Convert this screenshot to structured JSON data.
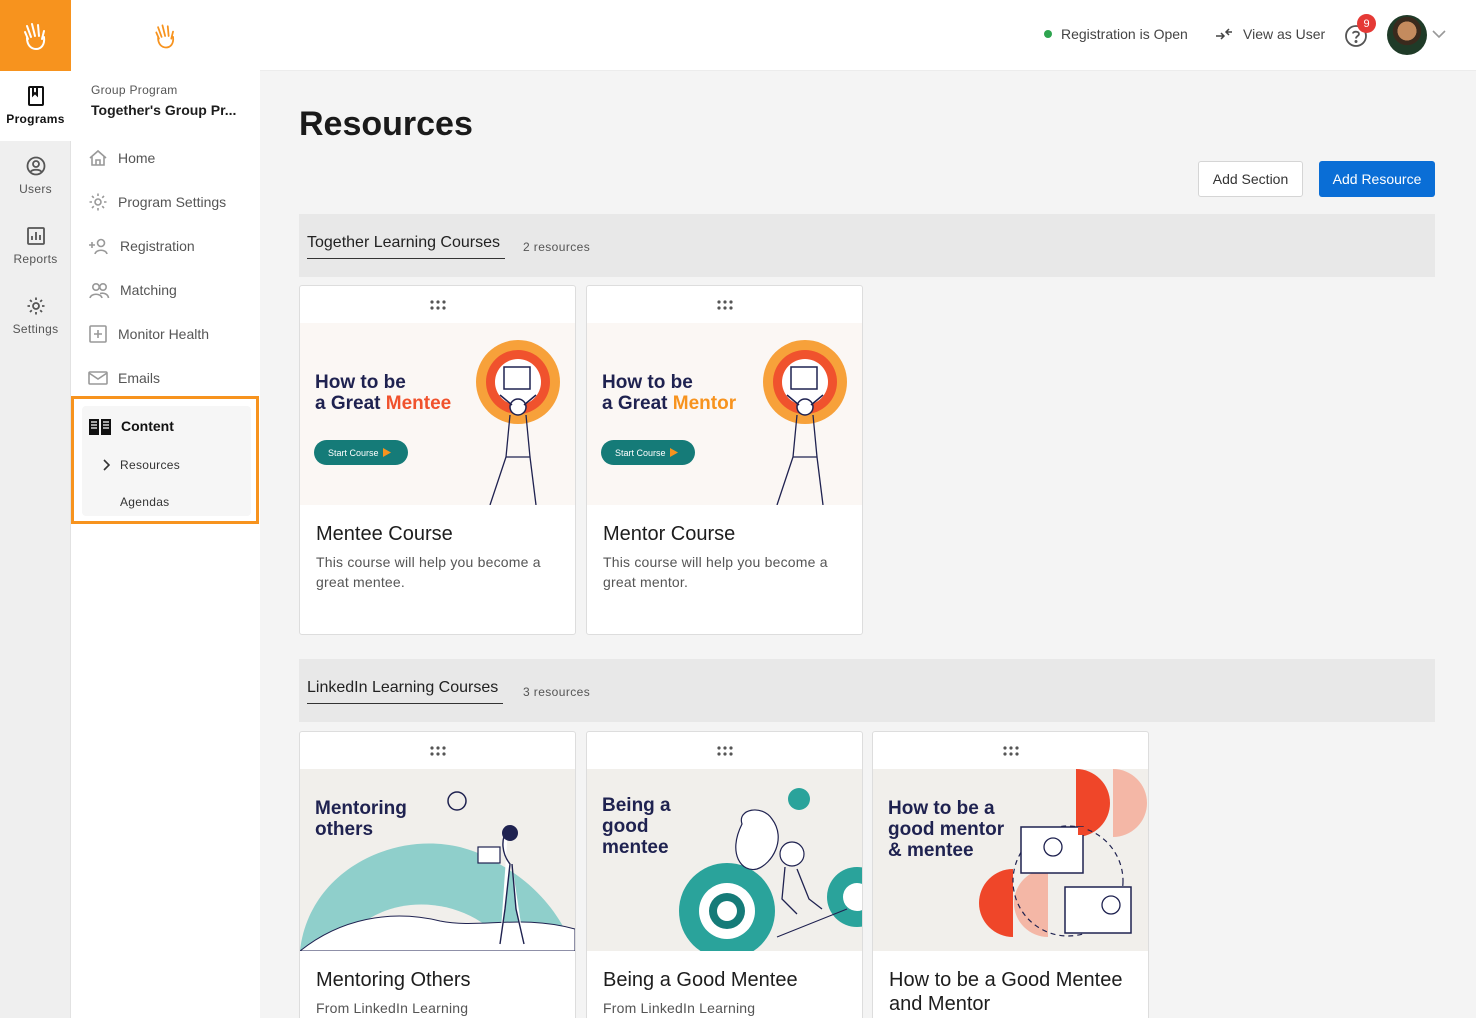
{
  "rail": {
    "items": [
      {
        "label": "Programs",
        "icon": "bookmark-icon"
      },
      {
        "label": "Users",
        "icon": "user-circle-icon"
      },
      {
        "label": "Reports",
        "icon": "bar-chart-icon"
      },
      {
        "label": "Settings",
        "icon": "gear-icon"
      }
    ]
  },
  "subnav": {
    "group_label": "Group Program",
    "group_name": "Together's Group Pr...",
    "items": [
      {
        "label": "Home",
        "icon": "home-icon"
      },
      {
        "label": "Program Settings",
        "icon": "gear-icon"
      },
      {
        "label": "Registration",
        "icon": "add-person-icon"
      },
      {
        "label": "Matching",
        "icon": "people-icon"
      },
      {
        "label": "Monitor Health",
        "icon": "plus-box-icon"
      },
      {
        "label": "Emails",
        "icon": "envelope-icon"
      }
    ],
    "content": {
      "label": "Content",
      "children": [
        "Resources",
        "Agendas"
      ]
    }
  },
  "topbar": {
    "status": "Registration is Open",
    "view_as": "View as User",
    "notification_count": "9"
  },
  "page": {
    "title": "Resources",
    "add_section": "Add Section",
    "add_resource": "Add Resource"
  },
  "sections": [
    {
      "title": "Together Learning Courses",
      "count": "2 resources",
      "cards": [
        {
          "thumb_line1": "How to be",
          "thumb_line2_a": "a Great ",
          "thumb_line2_b": "Mentee",
          "start": "Start Course",
          "title": "Mentee Course",
          "desc": "This course will help you become a great mentee."
        },
        {
          "thumb_line1": "How to be",
          "thumb_line2_a": "a Great ",
          "thumb_line2_b": "Mentor",
          "start": "Start Course",
          "title": "Mentor Course",
          "desc": "This course will help you become a great mentor."
        }
      ]
    },
    {
      "title": "LinkedIn Learning Courses",
      "count": "3 resources",
      "cards": [
        {
          "thumb_text": [
            "Mentoring",
            "others"
          ],
          "title": "Mentoring Others",
          "desc": "From LinkedIn Learning"
        },
        {
          "thumb_text": [
            "Being a",
            "good",
            "mentee"
          ],
          "title": "Being a Good Mentee",
          "desc": "From LinkedIn Learning"
        },
        {
          "thumb_text": [
            "How to be a",
            "good mentor",
            "& mentee"
          ],
          "title": "How to be a Good Mentee and Mentor",
          "desc": ""
        }
      ]
    }
  ],
  "colors": {
    "brand_orange": "#f7931e",
    "primary_blue": "#0a6ed6",
    "status_green": "#2ea44f",
    "badge_red": "#e53935",
    "mentee_accent": "#f0522d",
    "mentor_accent": "#f7931e",
    "teal": "#157b78"
  }
}
